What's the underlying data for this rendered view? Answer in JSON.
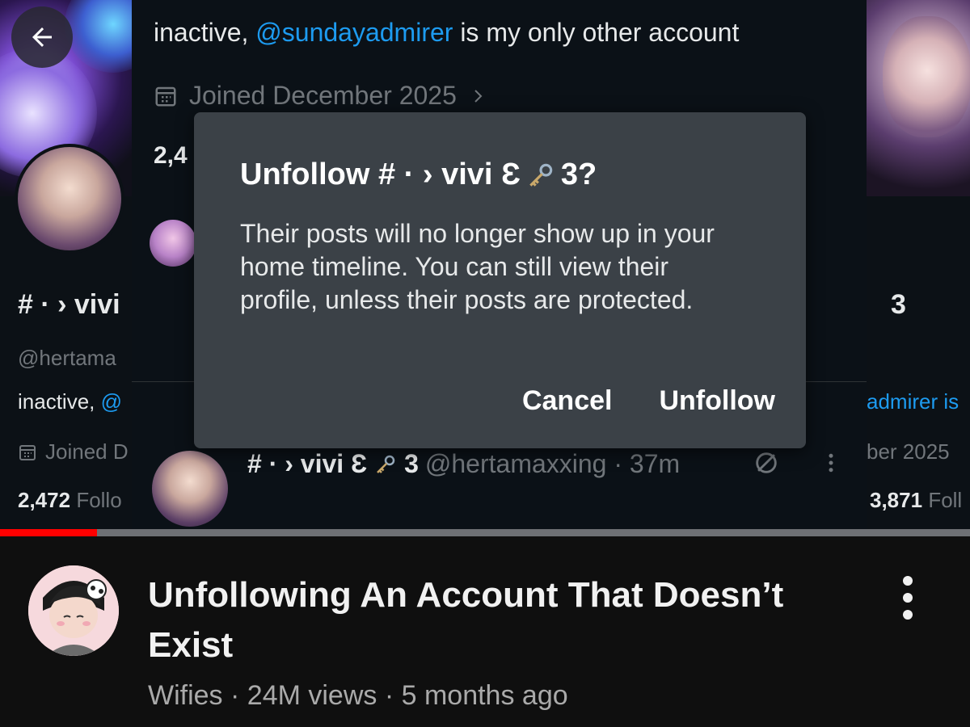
{
  "profile": {
    "display_name": "# · › vivi",
    "display_name_suffix": "3",
    "handle": "@hertamaxxing",
    "handle_partial": "@hertama",
    "bio_prefix": "inactive, ",
    "bio_mention": "@sundayadmirer",
    "bio_suffix": " is my only other account",
    "bio_left_partial": "inactive, @",
    "bio_right_partial": "admirer is",
    "joined": "Joined December 2025",
    "joined_left_partial": "Joined D",
    "joined_right_partial": "ber 2025",
    "followers_count_partial": "2,4",
    "left_count": "2,472",
    "left_count_label": "Follo",
    "right_count": "3,871",
    "right_count_label": "Foll"
  },
  "dialog": {
    "title": "Unfollow # · › vivi Ɛ",
    "title_end": "3?",
    "body": "Their posts will no longer show up in your home timeline. You can still view their profile, unless their posts are protected.",
    "cancel_label": "Cancel",
    "confirm_label": "Unfollow"
  },
  "post": {
    "name": "# · › vivi Ɛ",
    "name_end": "3",
    "handle_time": "@hertamaxxing · 37m"
  },
  "video": {
    "progress_fraction": 0.1,
    "title": "Unfollowing  An Account  That Doesn’t Exist",
    "channel": "Wifies",
    "views": "24M views",
    "age": "5 months ago",
    "meta_sep": " · "
  },
  "colors": {
    "accent_link": "#1d9bf0",
    "progress": "#ff0000",
    "dialog_bg": "#3b4147"
  },
  "icons": [
    "back-arrow-icon",
    "calendar-icon",
    "chevron-right-icon",
    "key-icon",
    "grok-icon",
    "more-vertical-icon"
  ]
}
